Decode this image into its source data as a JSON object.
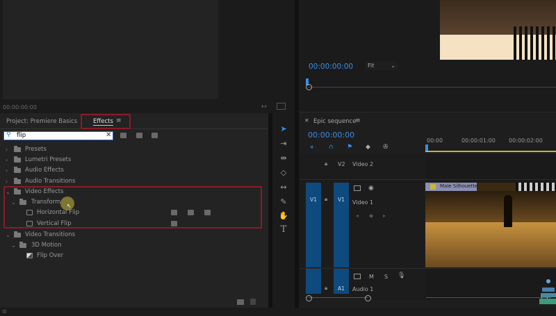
{
  "source_monitor": {
    "timecode": "00:00:00:00"
  },
  "program_monitor": {
    "timecode": "00:00:00:00",
    "fit": "Fit"
  },
  "panel": {
    "project_tab": "Project: Premiere Basics",
    "effects_tab": "Effects",
    "search_value": "flip",
    "tree": [
      {
        "label": "Presets"
      },
      {
        "label": "Lumetri Presets"
      },
      {
        "label": "Audio Effects"
      },
      {
        "label": "Audio Transitions"
      },
      {
        "label": "Video Effects"
      },
      {
        "label": "Transform"
      },
      {
        "label": "Horizontal Flip"
      },
      {
        "label": "Vertical Flip"
      },
      {
        "label": "Video Transitions"
      },
      {
        "label": "3D Motion"
      },
      {
        "label": "Flip Over"
      }
    ]
  },
  "timeline": {
    "sequence_name": "Epic sequence",
    "timecode": "00:00:00:00",
    "ruler": [
      "00:00",
      "00:00:01:00",
      "00:00:02:00"
    ],
    "tracks": {
      "v2": "V2",
      "v2_name": "Video 2",
      "v1_src": "V1",
      "v1": "V1",
      "v1_name": "Video 1",
      "a1": "A1",
      "a1_name": "Audio 1",
      "m": "M",
      "s": "S"
    },
    "clip_name": "Male Silhouette"
  },
  "toolbar": {
    "type_tool": "T"
  },
  "colors": {
    "accent": "#3c8ce8",
    "highlight": "#8a1c28",
    "track": "#0e4a7d"
  }
}
